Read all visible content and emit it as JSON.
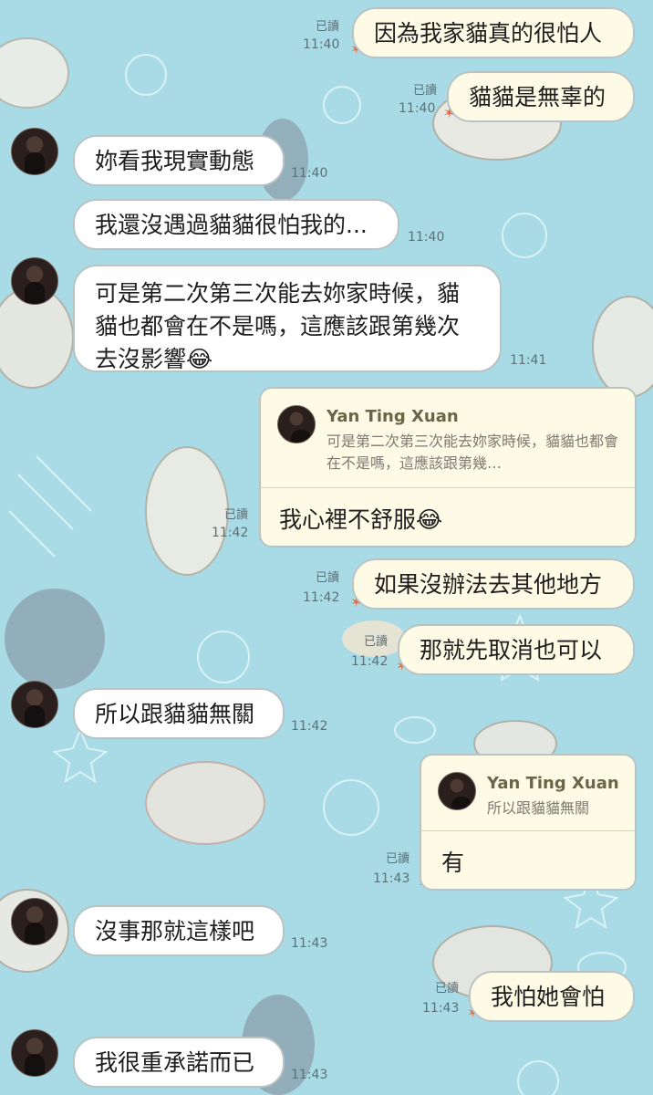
{
  "chat": {
    "messages": [
      {
        "id": "m1",
        "side": "out",
        "text": "因為我家貓真的很怕人",
        "read": "已讀",
        "time": "11:40"
      },
      {
        "id": "m2",
        "side": "out",
        "text": "貓貓是無辜的",
        "read": "已讀",
        "time": "11:40"
      },
      {
        "id": "m3",
        "side": "in",
        "text": "妳看我現實動態",
        "time": "11:40"
      },
      {
        "id": "m4",
        "side": "in",
        "text": "我還沒遇過貓貓很怕我的...",
        "time": "11:40"
      },
      {
        "id": "m5",
        "side": "in",
        "text": "可是第二次第三次能去妳家時候，貓貓也都會在不是嗎，這應該跟第幾次去沒影響😂",
        "time": "11:41"
      },
      {
        "id": "m6",
        "side": "out",
        "reply_name": "Yan Ting Xuan",
        "reply_quote": "可是第二次第三次能去妳家時候，貓貓也都會在不是嗎，這應該跟第幾…",
        "text": "我心裡不舒服😂",
        "read": "已讀",
        "time": "11:42"
      },
      {
        "id": "m7",
        "side": "out",
        "text": "如果沒辦法去其他地方",
        "read": "已讀",
        "time": "11:42"
      },
      {
        "id": "m8",
        "side": "out",
        "text": "那就先取消也可以",
        "read": "已讀",
        "time": "11:42"
      },
      {
        "id": "m9",
        "side": "in",
        "text": "所以跟貓貓無關",
        "time": "11:42"
      },
      {
        "id": "m10",
        "side": "out",
        "reply_name": "Yan Ting Xuan",
        "reply_quote": "所以跟貓貓無關",
        "text": "有",
        "read": "已讀",
        "time": "11:43"
      },
      {
        "id": "m11",
        "side": "in",
        "text": "沒事那就這樣吧",
        "time": "11:43"
      },
      {
        "id": "m12",
        "side": "out",
        "text": "我怕她會怕",
        "read": "已讀",
        "time": "11:43"
      },
      {
        "id": "m13",
        "side": "in",
        "text": "我很重承諾而已",
        "time": "11:43"
      }
    ]
  },
  "colors": {
    "background": "#a9dbe6",
    "bubble_in": "#ffffff",
    "bubble_out": "#fdfbe5",
    "bubble_border": "#b9c3c4",
    "star": "#d9714f"
  },
  "icons": {
    "avatar": "avatar",
    "read_marker": "starfish-icon"
  }
}
